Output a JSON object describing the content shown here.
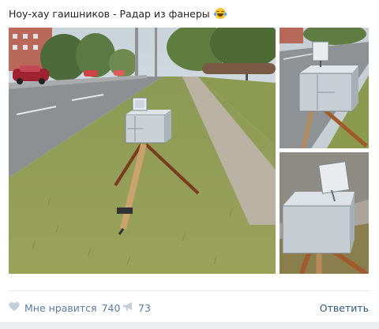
{
  "post": {
    "text": "Ноу-хау гаишников - Радар из фанеры",
    "emoji_icon": "laughing-tears-emoji"
  },
  "photos": [
    {
      "name": "main-photo",
      "description": ""
    },
    {
      "name": "top-right-photo",
      "description": ""
    },
    {
      "name": "bottom-right-photo",
      "description": ""
    }
  ],
  "actions": {
    "like_label": "Мне нравится",
    "like_count": "740",
    "share_count": "73",
    "reply_label": "Ответить"
  },
  "icons": {
    "like": "heart-icon",
    "share": "megaphone-icon"
  },
  "colors": {
    "link": "#2a5885",
    "muted": "#5a7ba3",
    "divider": "#e7e8ec"
  }
}
